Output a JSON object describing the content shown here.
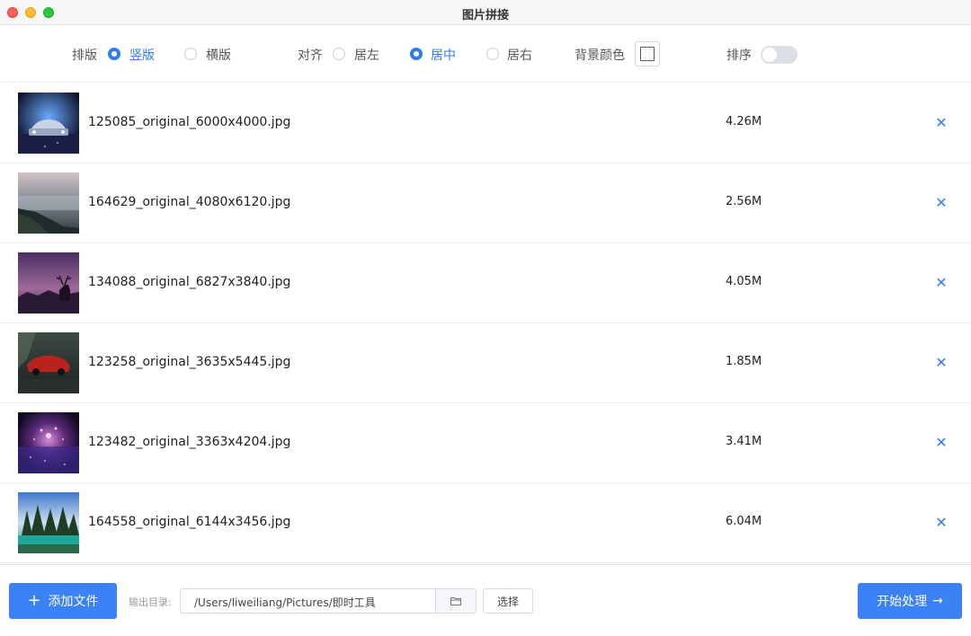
{
  "window": {
    "title": "图片拼接"
  },
  "options": {
    "layout": {
      "label": "排版",
      "vertical": "竖版",
      "horizontal": "横版",
      "selected": "竖版"
    },
    "align": {
      "label": "对齐",
      "left": "居左",
      "center": "居中",
      "right": "居右",
      "selected": "居中"
    },
    "background": {
      "label": "背景颜色",
      "color": "#ffffff"
    },
    "sort": {
      "label": "排序",
      "enabled": false
    }
  },
  "files": [
    {
      "name": "125085_original_6000x4000.jpg",
      "size": "4.26M",
      "thumb": "car-night"
    },
    {
      "name": "164629_original_4080x6120.jpg",
      "size": "2.56M",
      "thumb": "sea-rocks"
    },
    {
      "name": "134088_original_6827x3840.jpg",
      "size": "4.05M",
      "thumb": "deer-sunset"
    },
    {
      "name": "123258_original_3635x5445.jpg",
      "size": "1.85M",
      "thumb": "red-car"
    },
    {
      "name": "123482_original_3363x4204.jpg",
      "size": "3.41M",
      "thumb": "purple-lights"
    },
    {
      "name": "164558_original_6144x3456.jpg",
      "size": "6.04M",
      "thumb": "forest-lake"
    }
  ],
  "bottom": {
    "add_label": "添加文件",
    "output_label": "输出目录:",
    "output_path": "/Users/liweiliang/Pictures/即时工具",
    "choose_label": "选择",
    "start_label": "开始处理"
  },
  "colors": {
    "accent": "#3b82f6",
    "radio": "#2f7cf6"
  }
}
